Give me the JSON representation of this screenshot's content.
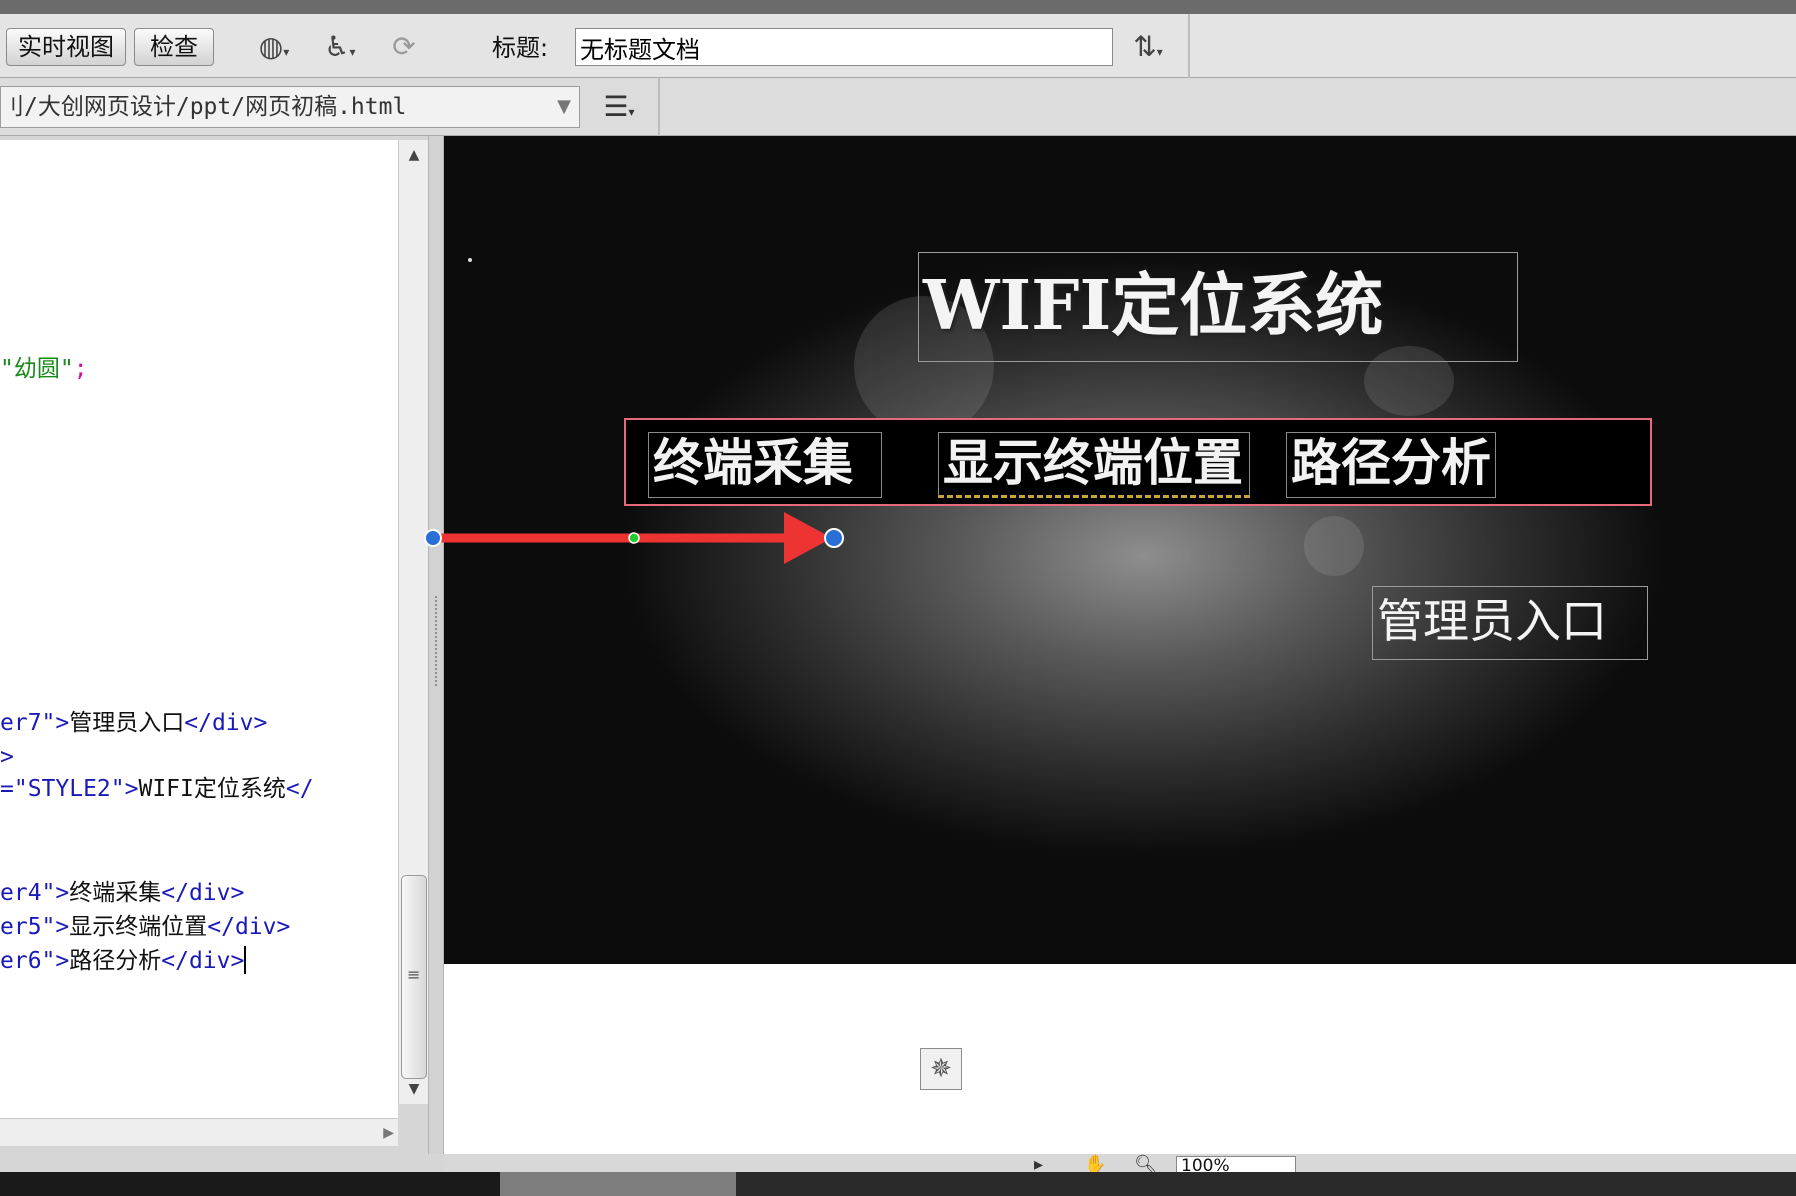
{
  "toolbar": {
    "live_view_label": "实时视图",
    "inspect_label": "检查",
    "title_label": "标题:",
    "title_value": "无标题文档",
    "preview_icon": "globe-icon",
    "accessibility_icon": "accessibility-icon",
    "refresh_icon": "refresh-icon",
    "file_manage_icon": "file-manage-icon"
  },
  "address": {
    "path": "刂/大创网页设计/ppt/网页初稿.html",
    "options_icon": "list-options-icon"
  },
  "code": {
    "lines": [
      {
        "text_green": "\"幼圆\"",
        "text_pink": ";"
      },
      {
        "tag_open": "er7\">",
        "text": "管理员入口",
        "tag_close": "</div>"
      },
      {
        "tag_open": ">"
      },
      {
        "tag_open": "=\"STYLE2\">",
        "text": "WIFI定位系统",
        "tag_close": "</"
      },
      {
        "tag_open": "er4\">",
        "text": "终端采集",
        "tag_close": "</div>"
      },
      {
        "tag_open": "er5\">",
        "text": "显示终端位置",
        "tag_close": "</div>"
      },
      {
        "tag_open": "er6\">",
        "text": "路径分析",
        "tag_close": "</div>"
      }
    ]
  },
  "design": {
    "title": "WIFI定位系统",
    "nav": [
      "终端采集",
      "显示终端位置",
      "路径分析"
    ],
    "admin": "管理员入口",
    "plugin_icon": "plugin-placeholder-icon"
  },
  "colors": {
    "annotation_arrow": "#ee3333",
    "annotation_handle": "#2a6fd6",
    "annotation_midpoint": "#22cc33",
    "nav_border": "#e86a78"
  },
  "status": {
    "zoom": "100%"
  }
}
